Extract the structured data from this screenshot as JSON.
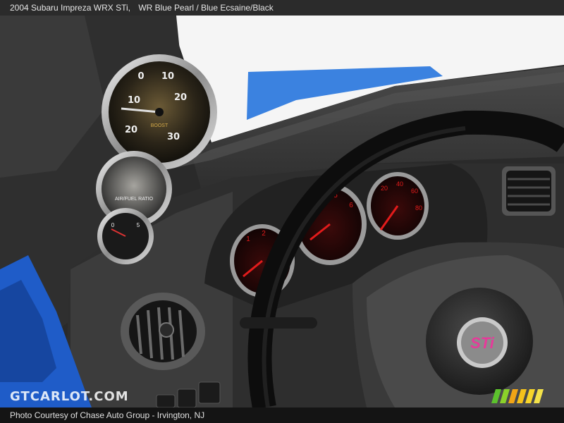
{
  "caption": {
    "title": "2004 Subaru Impreza WRX STi,",
    "color": "WR Blue Pearl / Blue Ecsaine/Black"
  },
  "photo": {
    "watermark": "GTCARLOT.COM",
    "credit": "Photo Courtesy of Chase Auto Group  -  Irvington, NJ",
    "gauge_labels": {
      "boost": "BOOST",
      "air_fuel": "AIR/FUEL RATIO"
    },
    "steering_badge": "STi"
  },
  "colors": {
    "sky": "#f4f4f4",
    "blue_paint": "#2f6fd6",
    "dash": "#3a3a3a",
    "cluster_red": "#d8131b"
  }
}
